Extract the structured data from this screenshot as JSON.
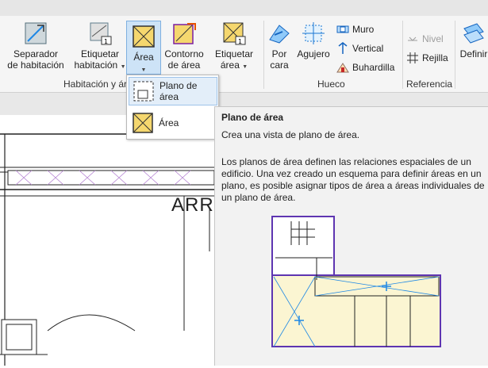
{
  "ribbon": {
    "buttons": [
      {
        "id": "sep",
        "label1": "Separador",
        "label2": "de habitación"
      },
      {
        "id": "etq",
        "label1": "Etiquetar",
        "label2": "habitación"
      },
      {
        "id": "area",
        "label1": "Área",
        "label2": ""
      },
      {
        "id": "contorno",
        "label1": "Contorno",
        "label2": "de área"
      },
      {
        "id": "etqarea",
        "label1": "Etiquetar",
        "label2": "área"
      },
      {
        "id": "porcara",
        "label1": "Por",
        "label2": "cara"
      },
      {
        "id": "agujero",
        "label1": "Agujero",
        "label2": ""
      },
      {
        "id": "definir",
        "label1": "Definir",
        "label2": ""
      }
    ],
    "small": {
      "muro": "Muro",
      "vertical": "Vertical",
      "buhardilla": "Buhardilla",
      "nivel": "Nivel",
      "rejilla": "Rejilla"
    },
    "panels": {
      "habitacion": "Habitación y ár",
      "hueco": "Hueco",
      "referencia": "Referencia"
    },
    "accent": "#f5d76e",
    "active_bg": "#cde3f7"
  },
  "dropdown": {
    "items": [
      {
        "label": "Plano de área"
      },
      {
        "label": "Área"
      }
    ]
  },
  "canvas": {
    "room_label": "ARR"
  },
  "tooltip": {
    "title": "Plano de área",
    "summary": "Crea una vista de plano de área.",
    "body": "Los planos de área definen las relaciones espaciales de un edificio. Una vez creado un esquema para definir áreas en un plano, es posible asignar tipos de área a áreas individuales de un plano de área."
  }
}
